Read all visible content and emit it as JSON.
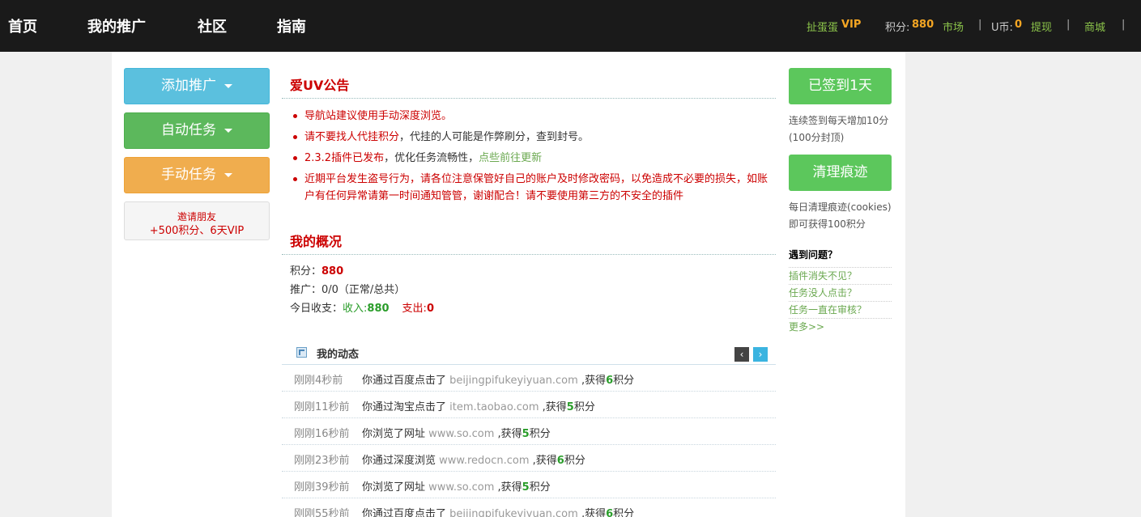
{
  "nav": {
    "items": [
      "首页",
      "我的推广",
      "社区",
      "指南"
    ]
  },
  "header_right": {
    "username": "扯蛋蛋",
    "vip": "VIP",
    "points_label": "积分:",
    "points": "880",
    "market": "市场",
    "ucoin_label": "U币:",
    "ucoin": "0",
    "withdraw": "提现",
    "shop": "商城"
  },
  "left": {
    "add_promo": "添加推广",
    "auto_task": "自动任务",
    "manual_task": "手动任务",
    "invite_line1": "邀请朋友",
    "invite_line2": "+500积分、6天VIP"
  },
  "announce": {
    "title": "爱UV公告",
    "items": [
      {
        "red": "导航站建议使用手动深度浏览。"
      },
      {
        "red": "请不要找人代挂积分",
        "black": "，代挂的人可能是作弊刷分，查到封号。"
      },
      {
        "red": "2.3.2插件已发布",
        "black": "，优化任务流畅性，",
        "green": "点些前往更新"
      },
      {
        "red": "近期平台发生盗号行为，请各位注意保管好自己的账户及时修改密码，以免造成不必要的损失，如账户有任何异常请第一时间通知管管，谢谢配合！请不要使用第三方的不安全的插件"
      }
    ]
  },
  "overview": {
    "title": "我的概况",
    "points_label": "积分：",
    "points": "880",
    "promo": "推广：0/0（正常/总共）",
    "today_label": "今日收支：",
    "income_label": "收入:",
    "income": "880",
    "expense_label": "支出:",
    "expense": "0"
  },
  "dynamics": {
    "title": "我的动态",
    "prev": "‹",
    "next": "›",
    "rows": [
      {
        "time": "刚刚4秒前",
        "pre": "你通过百度点击了 ",
        "url": "beijingpifukeyiyuan.com",
        "mid": " ,获得",
        "pts": "6",
        "suf": "积分"
      },
      {
        "time": "刚刚11秒前",
        "pre": "你通过淘宝点击了 ",
        "url": "item.taobao.com",
        "mid": " ,获得",
        "pts": "5",
        "suf": "积分"
      },
      {
        "time": "刚刚16秒前",
        "pre": "你浏览了网址 ",
        "url": "www.so.com",
        "mid": " ,获得",
        "pts": "5",
        "suf": "积分"
      },
      {
        "time": "刚刚23秒前",
        "pre": "你通过深度浏览 ",
        "url": "www.redocn.com",
        "mid": " ,获得",
        "pts": "6",
        "suf": "积分"
      },
      {
        "time": "刚刚39秒前",
        "pre": "你浏览了网址 ",
        "url": "www.so.com",
        "mid": " ,获得",
        "pts": "5",
        "suf": "积分"
      },
      {
        "time": "刚刚55秒前",
        "pre": "你通过百度点击了 ",
        "url": "beijingpifukeyiyuan.com",
        "mid": " ,获得",
        "pts": "6",
        "suf": "积分"
      }
    ]
  },
  "right": {
    "signed": "已签到1天",
    "sign_desc1": "连续签到每天增加10分",
    "sign_desc2": "(100分封顶)",
    "clear": "清理痕迹",
    "clear_desc1": "每日清理痕迹(cookies)",
    "clear_desc2": "即可获得100积分",
    "help_title": "遇到问题？",
    "help_items": [
      "插件消失不见？",
      "任务没人点击？",
      "任务一直在审核？",
      "更多>>"
    ]
  }
}
